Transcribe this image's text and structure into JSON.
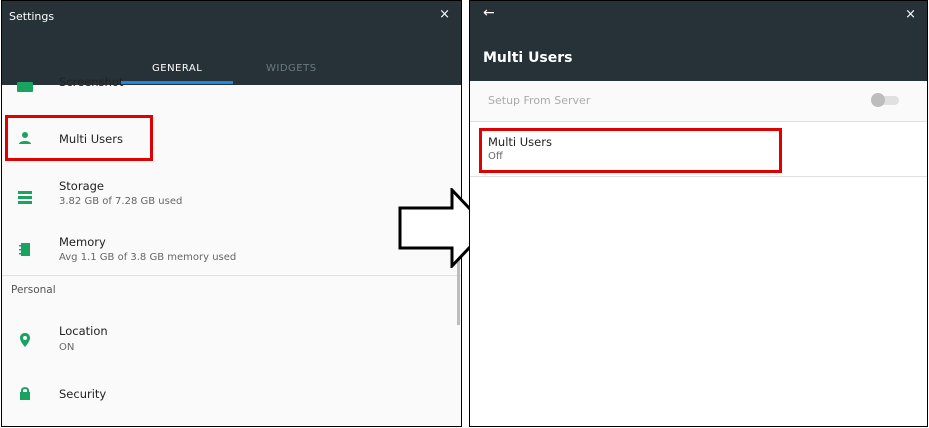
{
  "left_panel": {
    "title": "Settings",
    "close_glyph": "×",
    "tabs": [
      {
        "label": "GENERAL",
        "active": true
      },
      {
        "label": "WIDGETS",
        "active": false
      }
    ],
    "items": [
      {
        "label": "Screenshot",
        "icon": "screenshot-icon"
      },
      {
        "label": "Multi Users",
        "icon": "person-icon"
      },
      {
        "label": "Storage",
        "sub": "3.82 GB of 7.28 GB used",
        "icon": "storage-icon"
      },
      {
        "label": "Memory",
        "sub": "Avg 1.1 GB of 3.8 GB memory used",
        "icon": "memory-icon"
      }
    ],
    "section_header": "Personal",
    "personal_items": [
      {
        "label": "Location",
        "sub": "ON",
        "icon": "location-pin-icon"
      },
      {
        "label": "Security",
        "icon": "lock-icon"
      }
    ]
  },
  "right_panel": {
    "back_glyph": "←",
    "close_glyph": "×",
    "title": "Multi Users",
    "items": [
      {
        "label": "Setup From Server",
        "toggle_on": false,
        "disabled": true
      },
      {
        "label": "Multi Users",
        "sub": "Off"
      }
    ]
  },
  "colors": {
    "toolbar": "#263238",
    "accent": "#1e88e5",
    "icon_green": "#1aa260",
    "highlight_red": "#e00000"
  }
}
